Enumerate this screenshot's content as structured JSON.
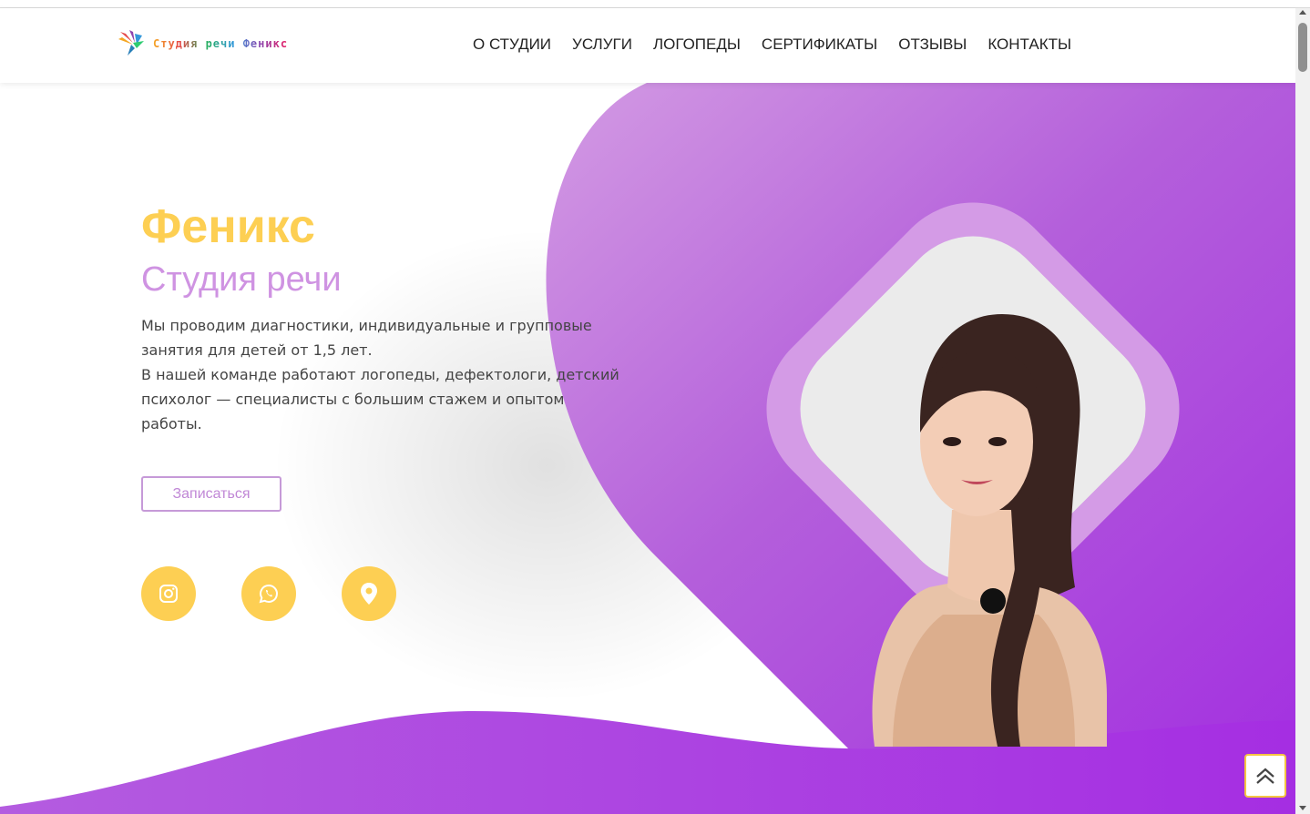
{
  "brand": {
    "logo_text": "Студия речи Феникс",
    "logo_icon": "phoenix-bird-icon"
  },
  "nav": {
    "items": [
      "О СТУДИИ",
      "УСЛУГИ",
      "ЛОГОПЕДЫ",
      "СЕРТИФИКАТЫ",
      "ОТЗЫВЫ",
      "КОНТАКТЫ"
    ]
  },
  "hero": {
    "title": "Феникс",
    "subtitle": "Студия речи",
    "description_line1": "Мы проводим диагностики, индивидуальные и групповые занятия для детей от 1,5 лет.",
    "description_line2": "В нашей команде работают логопеды, дефектологи, детский психолог — специалисты с большим стажем и опытом работы.",
    "cta_label": "Записаться"
  },
  "social": [
    {
      "icon": "instagram-icon"
    },
    {
      "icon": "whatsapp-icon"
    },
    {
      "icon": "location-pin-icon"
    }
  ],
  "colors": {
    "accent_yellow": "#fdcf53",
    "accent_purple": "#b04ae0",
    "subtitle_lilac": "#cf93e2"
  },
  "scroll_top_icon": "double-chevron-up-icon"
}
